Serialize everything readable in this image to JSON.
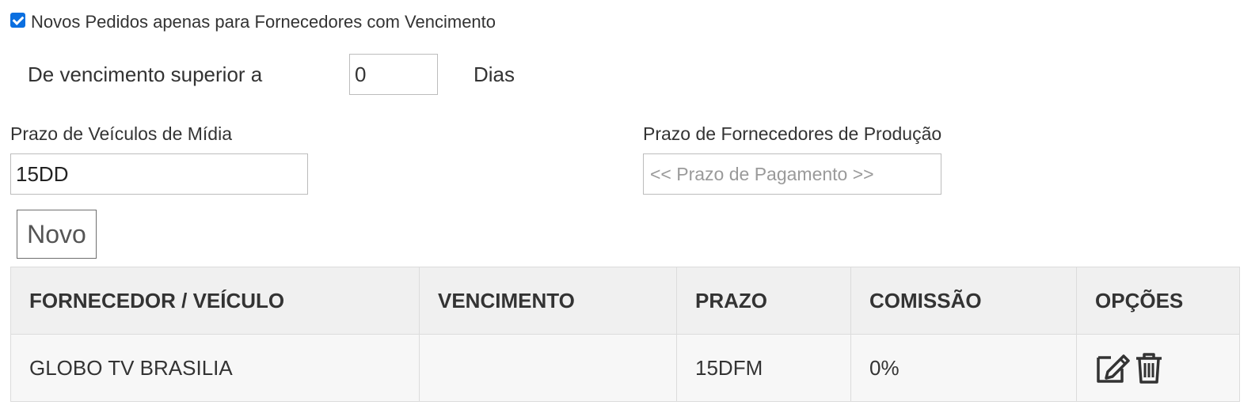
{
  "filter": {
    "checkbox_label": "Novos Pedidos apenas para Fornecedores com Vencimento",
    "checked": true,
    "venc_label": "De vencimento superior a",
    "venc_value": "0",
    "dias_label": "Dias"
  },
  "prazo_midia": {
    "label": "Prazo de Veículos de Mídia",
    "value": "15DD"
  },
  "prazo_producao": {
    "label": "Prazo de Fornecedores de Produção",
    "placeholder": "<< Prazo de Pagamento >>"
  },
  "novo_button": "Novo",
  "table": {
    "headers": [
      "FORNECEDOR / VEÍCULO",
      "VENCIMENTO",
      "PRAZO",
      "COMISSÃO",
      "OPÇÕES"
    ],
    "rows": [
      {
        "fornecedor": "GLOBO TV BRASILIA",
        "vencimento": "",
        "prazo": "15DFM",
        "comissao": "0%",
        "options": [
          "edit-icon",
          "trash-icon"
        ]
      }
    ]
  }
}
